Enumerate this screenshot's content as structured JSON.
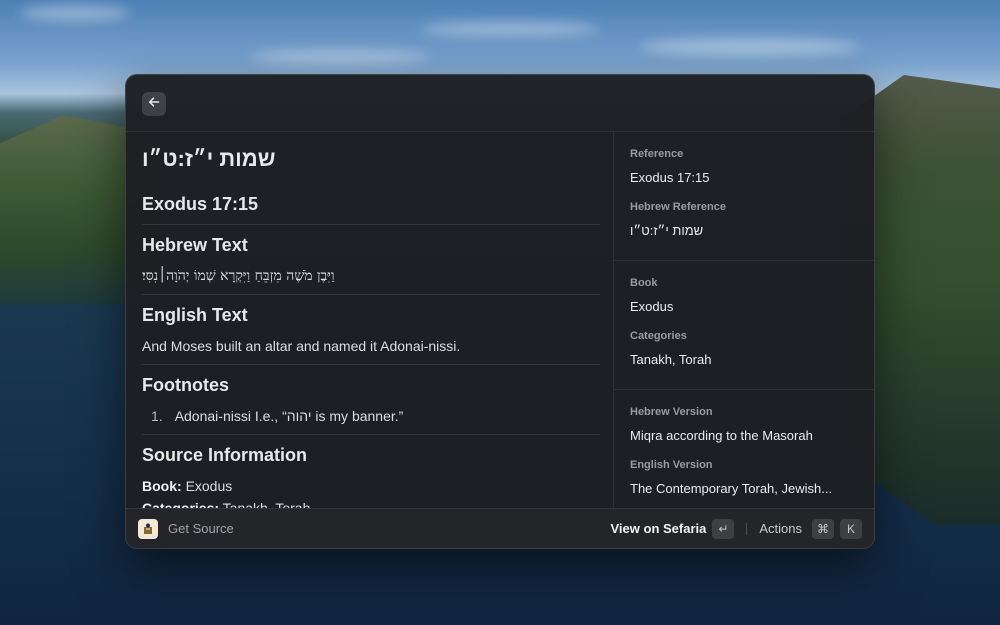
{
  "window": {
    "toolbar": {
      "back_icon": "arrow-left-icon"
    },
    "detail": {
      "hebrew_title": "שמות י״ז:ט״ו",
      "reference_title": "Exodus 17:15",
      "hebrew_heading": "Hebrew Text",
      "hebrew_text": "וַיִּבֶן מֹשֶׁה מִזְבֵּחַ וַיִּקְרָא שְׁמוֹ יְהֹוָה׀נִסִּי׃",
      "english_heading": "English Text",
      "english_text": "And Moses built an altar and named it Adonai-nissi.",
      "footnotes_heading": "Footnotes",
      "footnotes": [
        {
          "num": "1.",
          "text": "Adonai-nissi I.e., “יהוה is my banner.”"
        }
      ],
      "source_heading": "Source Information",
      "source_book_label": "Book:",
      "source_book_value": "Exodus",
      "source_categories_label": "Categories:",
      "source_categories_value": "Tanakh, Torah"
    },
    "metadata": {
      "reference_label": "Reference",
      "reference_value": "Exodus 17:15",
      "hebrew_reference_label": "Hebrew Reference",
      "hebrew_reference_value": "שמות י״ז:ט״ו",
      "book_label": "Book",
      "book_value": "Exodus",
      "categories_label": "Categories",
      "categories_value": "Tanakh, Torah",
      "hebrew_version_label": "Hebrew Version",
      "hebrew_version_value": "Miqra according to the Masorah",
      "english_version_label": "English Version",
      "english_version_value": "The Contemporary Torah, Jewish..."
    },
    "footer": {
      "app_icon": "sefaria-book-icon",
      "title": "Get Source",
      "primary_action": "View on Sefaria",
      "enter_key": "↵",
      "actions_label": "Actions",
      "cmd_key": "⌘",
      "k_key": "K"
    }
  }
}
